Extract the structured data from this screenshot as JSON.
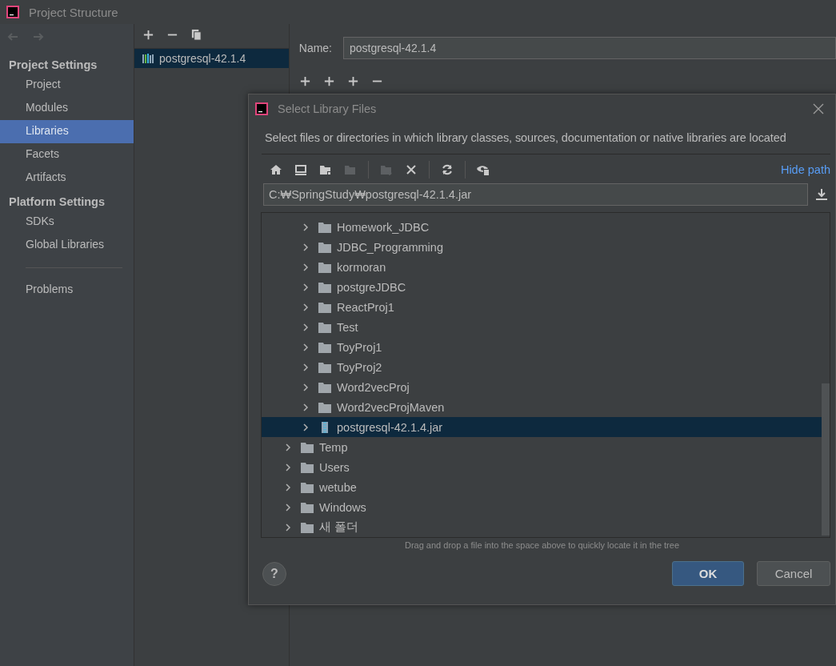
{
  "window": {
    "title": "Project Structure"
  },
  "sidebar": {
    "sections": [
      {
        "title": "Project Settings",
        "items": [
          {
            "label": "Project",
            "selected": false
          },
          {
            "label": "Modules",
            "selected": false
          },
          {
            "label": "Libraries",
            "selected": true
          },
          {
            "label": "Facets",
            "selected": false
          },
          {
            "label": "Artifacts",
            "selected": false
          }
        ]
      },
      {
        "title": "Platform Settings",
        "items": [
          {
            "label": "SDKs",
            "selected": false
          },
          {
            "label": "Global Libraries",
            "selected": false
          }
        ]
      }
    ],
    "footer_items": [
      {
        "label": "Problems",
        "selected": false
      }
    ]
  },
  "libraries": {
    "items": [
      {
        "label": "postgresql-42.1.4",
        "selected": true
      }
    ]
  },
  "details": {
    "name_label": "Name:",
    "name_value": "postgresql-42.1.4"
  },
  "dialog": {
    "title": "Select Library Files",
    "description": "Select files or directories in which library classes, sources, documentation or native libraries are located",
    "hide_path": "Hide path",
    "path": "C:₩SpringStudy₩postgresql-42.1.4.jar",
    "tree": {
      "scrolled_group": {
        "children": [
          {
            "label": "Homework_JDBC",
            "kind": "folder",
            "selected": false
          },
          {
            "label": "JDBC_Programming",
            "kind": "folder",
            "selected": false
          },
          {
            "label": "kormoran",
            "kind": "folder",
            "selected": false
          },
          {
            "label": "postgreJDBC",
            "kind": "folder",
            "selected": false
          },
          {
            "label": "ReactProj1",
            "kind": "folder",
            "selected": false
          },
          {
            "label": "Test",
            "kind": "folder",
            "selected": false
          },
          {
            "label": "ToyProj1",
            "kind": "folder",
            "selected": false
          },
          {
            "label": "ToyProj2",
            "kind": "folder",
            "selected": false
          },
          {
            "label": "Word2vecProj",
            "kind": "folder",
            "selected": false
          },
          {
            "label": "Word2vecProjMaven",
            "kind": "folder",
            "selected": false
          },
          {
            "label": "postgresql-42.1.4.jar",
            "kind": "jar",
            "selected": true
          }
        ]
      },
      "items": [
        {
          "label": "Temp",
          "kind": "folder",
          "selected": false
        },
        {
          "label": "Users",
          "kind": "folder",
          "selected": false
        },
        {
          "label": "wetube",
          "kind": "folder",
          "selected": false
        },
        {
          "label": "Windows",
          "kind": "folder",
          "selected": false
        },
        {
          "label": "새 폴더",
          "kind": "folder",
          "selected": false
        }
      ]
    },
    "hint": "Drag and drop a file into the space above to quickly locate it in the tree",
    "ok": "OK",
    "cancel": "Cancel",
    "help": "?"
  }
}
